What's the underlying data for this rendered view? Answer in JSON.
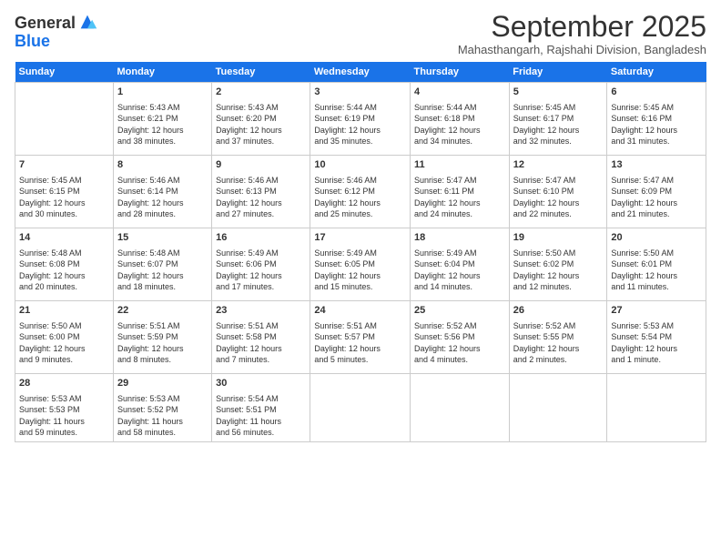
{
  "logo": {
    "line1": "General",
    "line2": "Blue"
  },
  "title": "September 2025",
  "location": "Mahasthangarh, Rajshahi Division, Bangladesh",
  "columns": [
    "Sunday",
    "Monday",
    "Tuesday",
    "Wednesday",
    "Thursday",
    "Friday",
    "Saturday"
  ],
  "weeks": [
    [
      {
        "day": "",
        "info": ""
      },
      {
        "day": "1",
        "info": "Sunrise: 5:43 AM\nSunset: 6:21 PM\nDaylight: 12 hours\nand 38 minutes."
      },
      {
        "day": "2",
        "info": "Sunrise: 5:43 AM\nSunset: 6:20 PM\nDaylight: 12 hours\nand 37 minutes."
      },
      {
        "day": "3",
        "info": "Sunrise: 5:44 AM\nSunset: 6:19 PM\nDaylight: 12 hours\nand 35 minutes."
      },
      {
        "day": "4",
        "info": "Sunrise: 5:44 AM\nSunset: 6:18 PM\nDaylight: 12 hours\nand 34 minutes."
      },
      {
        "day": "5",
        "info": "Sunrise: 5:45 AM\nSunset: 6:17 PM\nDaylight: 12 hours\nand 32 minutes."
      },
      {
        "day": "6",
        "info": "Sunrise: 5:45 AM\nSunset: 6:16 PM\nDaylight: 12 hours\nand 31 minutes."
      }
    ],
    [
      {
        "day": "7",
        "info": "Sunrise: 5:45 AM\nSunset: 6:15 PM\nDaylight: 12 hours\nand 30 minutes."
      },
      {
        "day": "8",
        "info": "Sunrise: 5:46 AM\nSunset: 6:14 PM\nDaylight: 12 hours\nand 28 minutes."
      },
      {
        "day": "9",
        "info": "Sunrise: 5:46 AM\nSunset: 6:13 PM\nDaylight: 12 hours\nand 27 minutes."
      },
      {
        "day": "10",
        "info": "Sunrise: 5:46 AM\nSunset: 6:12 PM\nDaylight: 12 hours\nand 25 minutes."
      },
      {
        "day": "11",
        "info": "Sunrise: 5:47 AM\nSunset: 6:11 PM\nDaylight: 12 hours\nand 24 minutes."
      },
      {
        "day": "12",
        "info": "Sunrise: 5:47 AM\nSunset: 6:10 PM\nDaylight: 12 hours\nand 22 minutes."
      },
      {
        "day": "13",
        "info": "Sunrise: 5:47 AM\nSunset: 6:09 PM\nDaylight: 12 hours\nand 21 minutes."
      }
    ],
    [
      {
        "day": "14",
        "info": "Sunrise: 5:48 AM\nSunset: 6:08 PM\nDaylight: 12 hours\nand 20 minutes."
      },
      {
        "day": "15",
        "info": "Sunrise: 5:48 AM\nSunset: 6:07 PM\nDaylight: 12 hours\nand 18 minutes."
      },
      {
        "day": "16",
        "info": "Sunrise: 5:49 AM\nSunset: 6:06 PM\nDaylight: 12 hours\nand 17 minutes."
      },
      {
        "day": "17",
        "info": "Sunrise: 5:49 AM\nSunset: 6:05 PM\nDaylight: 12 hours\nand 15 minutes."
      },
      {
        "day": "18",
        "info": "Sunrise: 5:49 AM\nSunset: 6:04 PM\nDaylight: 12 hours\nand 14 minutes."
      },
      {
        "day": "19",
        "info": "Sunrise: 5:50 AM\nSunset: 6:02 PM\nDaylight: 12 hours\nand 12 minutes."
      },
      {
        "day": "20",
        "info": "Sunrise: 5:50 AM\nSunset: 6:01 PM\nDaylight: 12 hours\nand 11 minutes."
      }
    ],
    [
      {
        "day": "21",
        "info": "Sunrise: 5:50 AM\nSunset: 6:00 PM\nDaylight: 12 hours\nand 9 minutes."
      },
      {
        "day": "22",
        "info": "Sunrise: 5:51 AM\nSunset: 5:59 PM\nDaylight: 12 hours\nand 8 minutes."
      },
      {
        "day": "23",
        "info": "Sunrise: 5:51 AM\nSunset: 5:58 PM\nDaylight: 12 hours\nand 7 minutes."
      },
      {
        "day": "24",
        "info": "Sunrise: 5:51 AM\nSunset: 5:57 PM\nDaylight: 12 hours\nand 5 minutes."
      },
      {
        "day": "25",
        "info": "Sunrise: 5:52 AM\nSunset: 5:56 PM\nDaylight: 12 hours\nand 4 minutes."
      },
      {
        "day": "26",
        "info": "Sunrise: 5:52 AM\nSunset: 5:55 PM\nDaylight: 12 hours\nand 2 minutes."
      },
      {
        "day": "27",
        "info": "Sunrise: 5:53 AM\nSunset: 5:54 PM\nDaylight: 12 hours\nand 1 minute."
      }
    ],
    [
      {
        "day": "28",
        "info": "Sunrise: 5:53 AM\nSunset: 5:53 PM\nDaylight: 11 hours\nand 59 minutes."
      },
      {
        "day": "29",
        "info": "Sunrise: 5:53 AM\nSunset: 5:52 PM\nDaylight: 11 hours\nand 58 minutes."
      },
      {
        "day": "30",
        "info": "Sunrise: 5:54 AM\nSunset: 5:51 PM\nDaylight: 11 hours\nand 56 minutes."
      },
      {
        "day": "",
        "info": ""
      },
      {
        "day": "",
        "info": ""
      },
      {
        "day": "",
        "info": ""
      },
      {
        "day": "",
        "info": ""
      }
    ]
  ]
}
